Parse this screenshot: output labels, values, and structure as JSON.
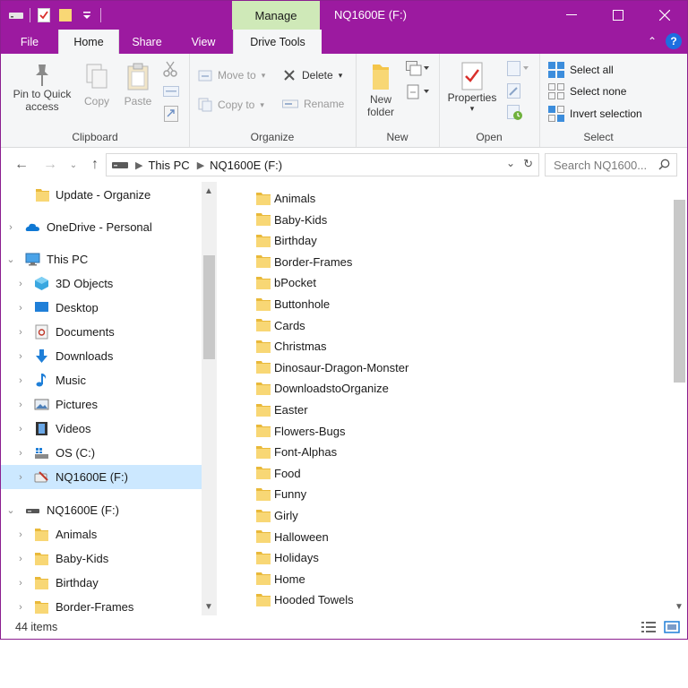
{
  "window": {
    "title": "NQ1600E (F:)",
    "context_tab": "Manage",
    "accent": "#9c1aa0"
  },
  "tabs": {
    "file": "File",
    "home": "Home",
    "share": "Share",
    "view": "View",
    "drive_tools": "Drive Tools"
  },
  "ribbon": {
    "clipboard": {
      "label": "Clipboard",
      "pin": "Pin to Quick access",
      "copy": "Copy",
      "paste": "Paste"
    },
    "organize": {
      "label": "Organize",
      "move_to": "Move to",
      "copy_to": "Copy to",
      "delete": "Delete",
      "rename": "Rename"
    },
    "new": {
      "label": "New",
      "new_folder": "New folder"
    },
    "open": {
      "label": "Open",
      "properties": "Properties"
    },
    "select": {
      "label": "Select",
      "select_all": "Select all",
      "select_none": "Select none",
      "invert": "Invert selection"
    }
  },
  "address": {
    "crumbs": [
      "This PC",
      "NQ1600E (F:)"
    ],
    "search_placeholder": "Search NQ1600..."
  },
  "nav": {
    "items": [
      {
        "label": "Update - Organize",
        "icon": "folder-icon"
      },
      {
        "label": "OneDrive - Personal",
        "icon": "cloud-icon"
      },
      {
        "label": "This PC",
        "icon": "computer-icon"
      },
      {
        "label": "3D Objects",
        "icon": "cube-icon"
      },
      {
        "label": "Desktop",
        "icon": "desktop-icon"
      },
      {
        "label": "Documents",
        "icon": "documents-icon"
      },
      {
        "label": "Downloads",
        "icon": "download-arrow-icon"
      },
      {
        "label": "Music",
        "icon": "music-note-icon"
      },
      {
        "label": "Pictures",
        "icon": "pictures-icon"
      },
      {
        "label": "Videos",
        "icon": "film-icon"
      },
      {
        "label": "OS (C:)",
        "icon": "windows-drive-icon"
      },
      {
        "label": "NQ1600E (F:)",
        "icon": "removable-drive-icon"
      },
      {
        "label": "NQ1600E (F:)",
        "icon": "usb-drive-icon"
      },
      {
        "label": "Animals",
        "icon": "folder-icon"
      },
      {
        "label": "Baby-Kids",
        "icon": "folder-icon"
      },
      {
        "label": "Birthday",
        "icon": "folder-icon"
      },
      {
        "label": "Border-Frames",
        "icon": "folder-icon"
      }
    ]
  },
  "files": [
    "Animals",
    "Baby-Kids",
    "Birthday",
    "Border-Frames",
    "bPocket",
    "Buttonhole",
    "Cards",
    "Christmas",
    "Dinosaur-Dragon-Monster",
    "DownloadstoOrganize",
    "Easter",
    "Flowers-Bugs",
    "Font-Alphas",
    "Food",
    "Funny",
    "Girly",
    "Halloween",
    "Holidays",
    "Home",
    "Hooded Towels"
  ],
  "status": {
    "item_count": "44 items"
  }
}
